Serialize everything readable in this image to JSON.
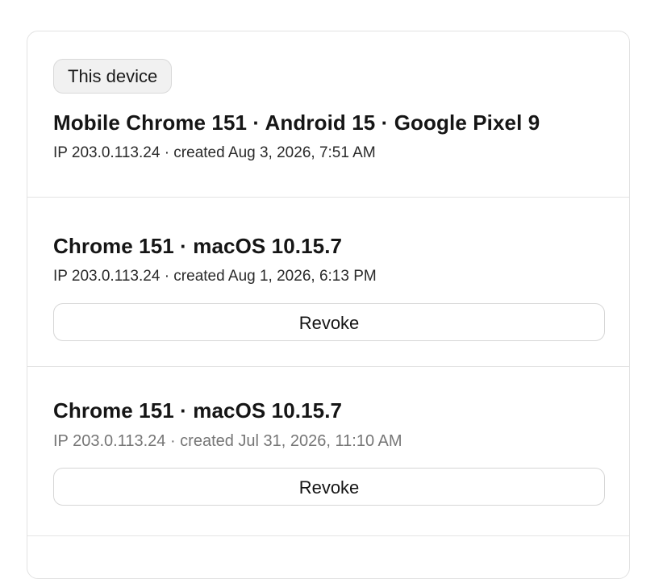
{
  "sessions": [
    {
      "badge": "This device",
      "title": "Mobile Chrome 151 · Android 15 · Google Pixel 9",
      "meta": "IP 203.0.113.24 · created Aug 3, 2026, 7:51 AM"
    },
    {
      "title": "Chrome 151 · macOS 10.15.7",
      "meta": "IP 203.0.113.24 · created Aug 1, 2026, 6:13 PM",
      "action_label": "Revoke"
    },
    {
      "title": "Chrome 151 · macOS 10.15.7",
      "meta": "IP 203.0.113.24 · created Jul 31, 2026, 11:10 AM",
      "action_label": "Revoke"
    }
  ]
}
